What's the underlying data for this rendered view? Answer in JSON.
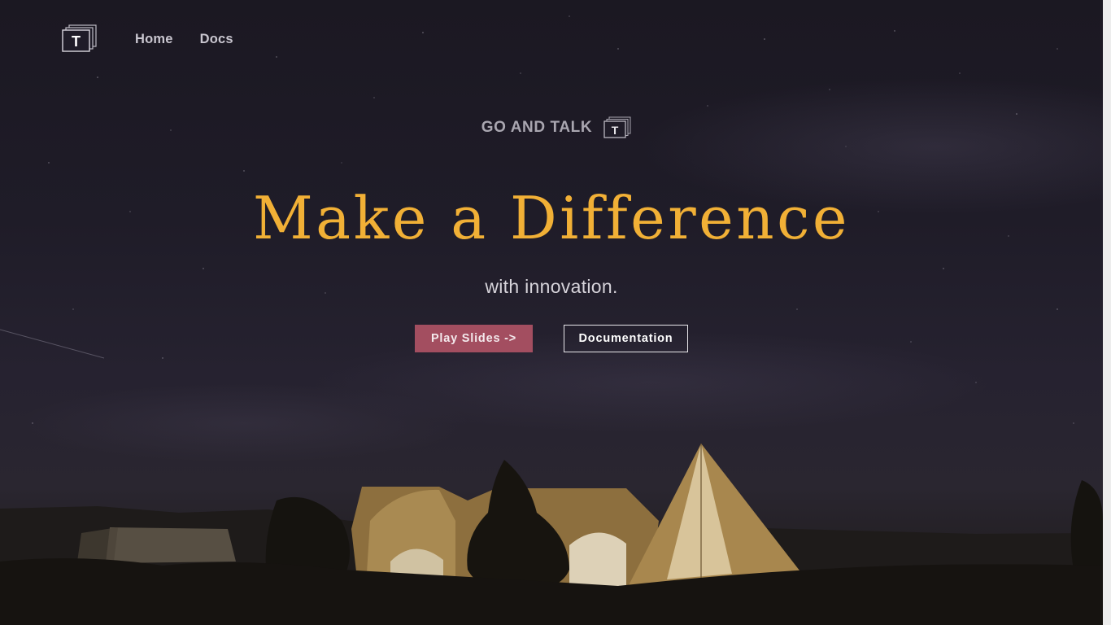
{
  "nav": {
    "logo_letter": "T",
    "links": [
      {
        "label": "Home"
      },
      {
        "label": "Docs"
      }
    ]
  },
  "hero": {
    "brand": "GO AND TALK",
    "brand_logo_letter": "T",
    "headline": "Make a Difference",
    "subhead": "with innovation.",
    "primary_button": "Play Slides ->",
    "secondary_button": "Documentation"
  },
  "colors": {
    "headline": "#f1b036",
    "primary_button": "#a34e60",
    "background": "#1f1c28"
  },
  "icons": {
    "logo": "stacked-slides-T-icon"
  }
}
